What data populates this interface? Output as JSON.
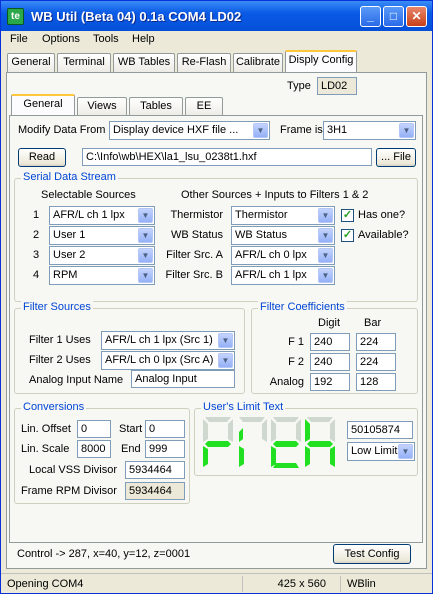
{
  "window": {
    "title": "WB Util (Beta 04) 0.1a  COM4 LD02",
    "icon_text": "te"
  },
  "menu": [
    "File",
    "Options",
    "Tools",
    "Help"
  ],
  "main_tabs": [
    "General",
    "Terminal",
    "WB Tables",
    "Re-Flash",
    "Calibrate",
    "Disply Config"
  ],
  "type_label": "Type",
  "type_value": "LD02",
  "sub_tabs": [
    "General",
    "Views",
    "Tables",
    "EE"
  ],
  "modify": {
    "label": "Modify Data From",
    "value": "Display device HXF file ...",
    "frame_label": "Frame is",
    "frame_value": "3H1"
  },
  "read_button": "Read",
  "file_path": "C:\\Info\\wb\\HEX\\la1_lsu_0238t1.hxf",
  "file_button": "... File",
  "serial": {
    "title": "Serial Data Stream",
    "selectable_header": "Selectable Sources",
    "other_header": "Other Sources + Inputs to Filters 1 & 2",
    "rows": [
      {
        "num": "1",
        "source": "AFR/L ch 1 lpx",
        "label": "Thermistor",
        "value": "Thermistor",
        "check_label": "Has one?"
      },
      {
        "num": "2",
        "source": "User 1",
        "label": "WB Status",
        "value": "WB Status",
        "check_label": "Available?"
      },
      {
        "num": "3",
        "source": "User 2",
        "label": "Filter Src. A",
        "value": "AFR/L ch 0 lpx"
      },
      {
        "num": "4",
        "source": "RPM",
        "label": "Filter Src. B",
        "value": "AFR/L ch 1 lpx"
      }
    ]
  },
  "filter_sources": {
    "title": "Filter Sources",
    "f1_label": "Filter 1 Uses",
    "f1_value": "AFR/L ch 1 lpx (Src 1)",
    "f2_label": "Filter 2 Uses",
    "f2_value": "AFR/L ch 0 lpx (Src A)",
    "analog_label": "Analog Input Name",
    "analog_value": "Analog Input"
  },
  "coeffs": {
    "title": "Filter Coefficients",
    "col_digit": "Digit",
    "col_bar": "Bar",
    "rows": [
      {
        "label": "F 1",
        "digit": "240",
        "bar": "224"
      },
      {
        "label": "F 2",
        "digit": "240",
        "bar": "224"
      },
      {
        "label": "Analog",
        "digit": "192",
        "bar": "128"
      }
    ]
  },
  "conversions": {
    "title": "Conversions",
    "lin_offset_label": "Lin. Offset",
    "lin_offset": "0",
    "start_label": "Start",
    "start": "0",
    "lin_scale_label": "Lin. Scale",
    "lin_scale": "8000",
    "end_label": "End",
    "end": "999",
    "vss_label": "Local VSS Divisor",
    "vss": "5934464",
    "rpm_label": "Frame RPM Divisor",
    "rpm": "5934464"
  },
  "limit": {
    "title": "User's Limit Text",
    "display_text": "rIch",
    "code": "50105874",
    "select": "Low Limit",
    "display_color": "#21e021"
  },
  "control_text": "Control -> 287, x=40, y=12, z=0001",
  "test_button": "Test Config",
  "status": {
    "left": "Opening COM4",
    "size": "425 x 560",
    "right": "WBlin"
  }
}
